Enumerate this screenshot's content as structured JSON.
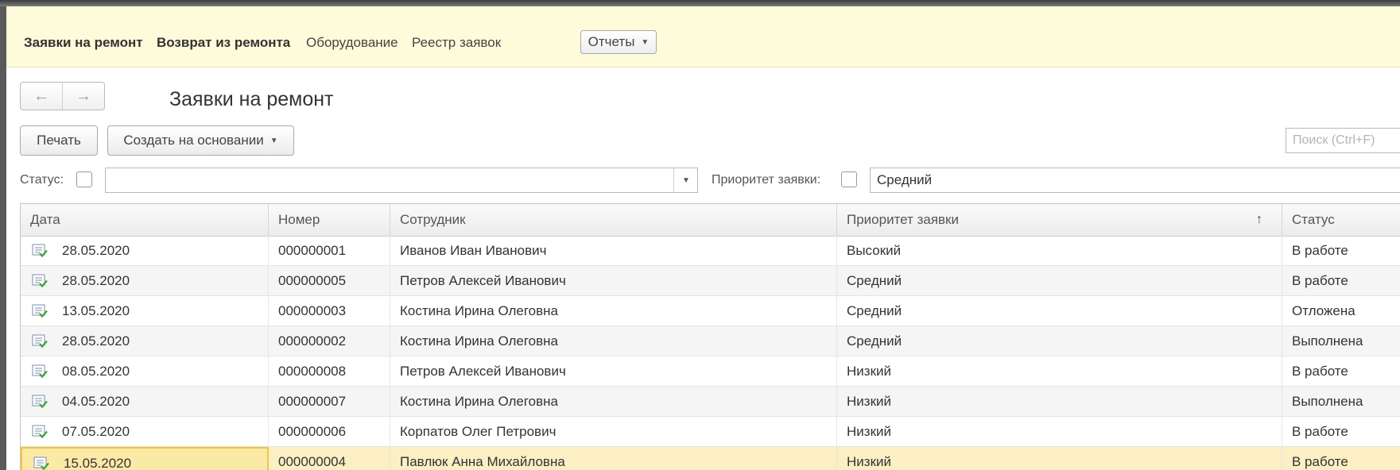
{
  "sections": {
    "items": [
      {
        "label": "Заявки на ремонт",
        "bold": true
      },
      {
        "label": "Возврат из ремонта",
        "bold": true
      },
      {
        "label": "Оборудование",
        "bold": false
      },
      {
        "label": "Реестр заявок",
        "bold": false
      }
    ],
    "reports_label": "Отчеты"
  },
  "form": {
    "title": "Заявки на ремонт"
  },
  "commands": {
    "print_label": "Печать",
    "create_based_label": "Создать на основании",
    "search_placeholder": "Поиск (Ctrl+F)"
  },
  "filters": {
    "status_label": "Статус:",
    "status_value": "",
    "priority_label": "Приоритет заявки:",
    "priority_value": "Средний"
  },
  "table": {
    "columns": {
      "date": "Дата",
      "number": "Номер",
      "employee": "Сотрудник",
      "priority": "Приоритет заявки",
      "status": "Статус"
    },
    "sort_indicator": "↑",
    "rows": [
      {
        "date": "28.05.2020",
        "number": "000000001",
        "employee": "Иванов Иван Иванович",
        "priority": "Высокий",
        "status": "В работе"
      },
      {
        "date": "28.05.2020",
        "number": "000000005",
        "employee": "Петров Алексей Иванович",
        "priority": "Средний",
        "status": "В работе"
      },
      {
        "date": "13.05.2020",
        "number": "000000003",
        "employee": "Костина Ирина Олеговна",
        "priority": "Средний",
        "status": "Отложена"
      },
      {
        "date": "28.05.2020",
        "number": "000000002",
        "employee": "Костина Ирина Олеговна",
        "priority": "Средний",
        "status": "Выполнена"
      },
      {
        "date": "08.05.2020",
        "number": "000000008",
        "employee": "Петров Алексей Иванович",
        "priority": "Низкий",
        "status": "В работе"
      },
      {
        "date": "04.05.2020",
        "number": "000000007",
        "employee": "Костина Ирина Олеговна",
        "priority": "Низкий",
        "status": "Выполнена"
      },
      {
        "date": "07.05.2020",
        "number": "000000006",
        "employee": "Корпатов Олег Петрович",
        "priority": "Низкий",
        "status": "В работе"
      },
      {
        "date": "15.05.2020",
        "number": "000000004",
        "employee": "Павлюк Анна Михайловна",
        "priority": "Низкий",
        "status": "В работе",
        "selected": true
      }
    ]
  },
  "colors": {
    "section_bg": "#fdfbd9",
    "selected_row": "#fbefc3",
    "selected_cell_border": "#f2c53d"
  }
}
